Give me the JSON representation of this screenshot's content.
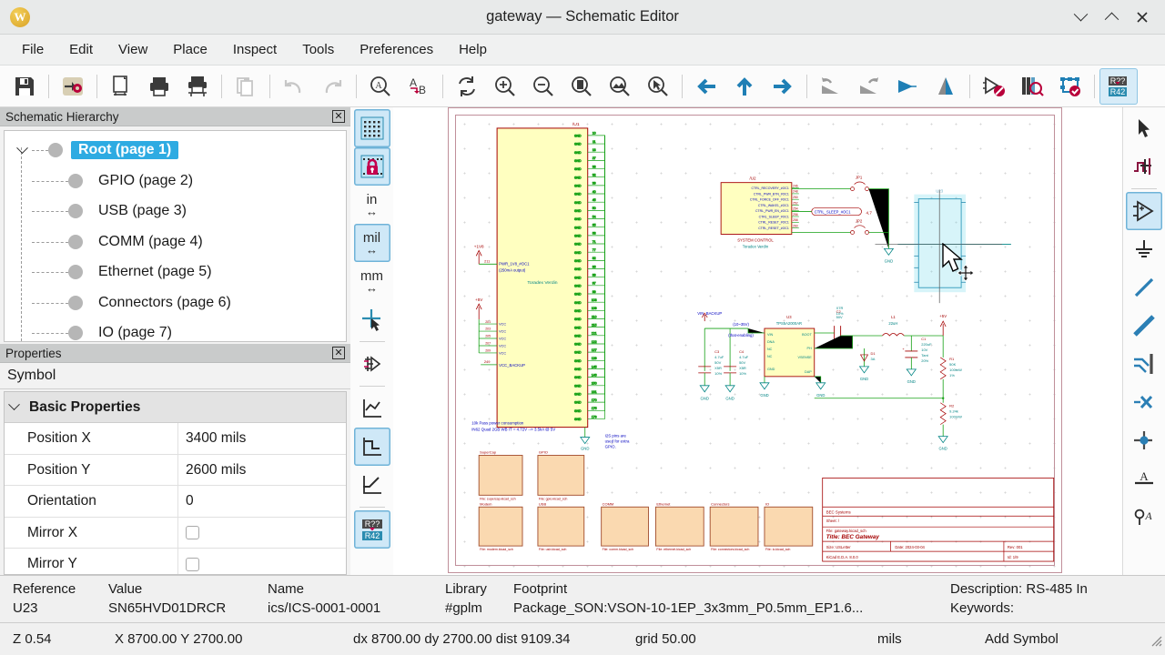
{
  "window": {
    "title": "gateway — Schematic Editor",
    "logo_letter": "W",
    "controls": {
      "minimize": "minimize-icon",
      "maximize": "maximize-icon",
      "close": "×"
    }
  },
  "menubar": {
    "items": [
      "File",
      "Edit",
      "View",
      "Place",
      "Inspect",
      "Tools",
      "Preferences",
      "Help"
    ]
  },
  "toolbar": {
    "items": [
      {
        "name": "save-icon",
        "label": "Save"
      },
      {
        "sep": true
      },
      {
        "name": "open-project-settings-icon",
        "label": "Schematic Setup"
      },
      {
        "sep": true
      },
      {
        "name": "page-settings-icon",
        "label": "Page Settings"
      },
      {
        "name": "print-icon",
        "label": "Print"
      },
      {
        "name": "plot-icon",
        "label": "Plot"
      },
      {
        "sep": true
      },
      {
        "name": "paste-icon",
        "label": "Paste"
      },
      {
        "sep": true
      },
      {
        "name": "undo-icon",
        "label": "Undo"
      },
      {
        "name": "redo-icon",
        "label": "Redo"
      },
      {
        "sep": true
      },
      {
        "name": "find-icon",
        "label": "Find"
      },
      {
        "name": "find-replace-icon",
        "label": "Find and Replace"
      },
      {
        "sep": true
      },
      {
        "name": "refresh-icon",
        "label": "Refresh"
      },
      {
        "name": "zoom-in-icon",
        "label": "Zoom In"
      },
      {
        "name": "zoom-out-icon",
        "label": "Zoom Out"
      },
      {
        "name": "zoom-fit-page-icon",
        "label": "Zoom to Fit Page"
      },
      {
        "name": "zoom-fit-objects-icon",
        "label": "Zoom to Objects"
      },
      {
        "name": "zoom-selection-icon",
        "label": "Zoom to Selection"
      },
      {
        "sep": true
      },
      {
        "name": "leave-sheet-icon",
        "label": "Leave Sheet"
      },
      {
        "name": "up-sheet-icon",
        "label": "Navigate Up"
      },
      {
        "name": "enter-sheet-icon",
        "label": "Enter Sheet"
      },
      {
        "sep": true
      },
      {
        "name": "rotate-ccw-icon",
        "label": "Rotate Counterclockwise"
      },
      {
        "name": "rotate-cw-icon",
        "label": "Rotate Clockwise"
      },
      {
        "name": "mirror-horizontal-icon",
        "label": "Mirror Horizontally"
      },
      {
        "name": "mirror-vertical-icon",
        "label": "Mirror Vertically"
      },
      {
        "sep": true
      },
      {
        "name": "erc-icon",
        "label": "Electrical Rules Checker"
      },
      {
        "name": "symbol-library-browser-icon",
        "label": "Symbol Library Browser"
      },
      {
        "name": "assign-footprints-icon",
        "label": "Assign Footprints"
      },
      {
        "sep": true
      },
      {
        "name": "annotate-icon",
        "label": "Annotate",
        "active": true
      }
    ]
  },
  "hierarchy": {
    "title": "Schematic Hierarchy",
    "close": "✖",
    "items": [
      {
        "label": "Root (page 1)",
        "selected": true
      },
      {
        "label": "GPIO (page 2)",
        "selected": false
      },
      {
        "label": "USB (page 3)",
        "selected": false
      },
      {
        "label": "COMM (page 4)",
        "selected": false
      },
      {
        "label": "Ethernet (page 5)",
        "selected": false
      },
      {
        "label": "Connectors (page 6)",
        "selected": false
      },
      {
        "label": "IO (page 7)",
        "selected": false
      }
    ]
  },
  "properties": {
    "title": "Properties",
    "close": "✖",
    "subtitle": "Symbol",
    "group_label": "Basic Properties",
    "rows": [
      {
        "key": "Position X",
        "value": "3400 mils",
        "type": "text"
      },
      {
        "key": "Position Y",
        "value": "2600 mils",
        "type": "text"
      },
      {
        "key": "Orientation",
        "value": "0",
        "type": "text"
      },
      {
        "key": "Mirror X",
        "value": "",
        "type": "checkbox"
      },
      {
        "key": "Mirror Y",
        "value": "",
        "type": "checkbox"
      }
    ]
  },
  "left_vtoolbar": {
    "items": [
      {
        "name": "grid-visibility-icon",
        "label": "Show Grid",
        "active": true
      },
      {
        "name": "grid-lock-icon",
        "label": "Lock Grid",
        "active": true
      },
      {
        "name": "unit-inches-icon",
        "label": "in",
        "active": false
      },
      {
        "name": "unit-mils-icon",
        "label": "mil",
        "active": true
      },
      {
        "name": "unit-millimeters-icon",
        "label": "mm",
        "active": false
      },
      {
        "name": "full-crosshair-icon",
        "label": "Full Window Crosshair",
        "active": false
      },
      {
        "name": "hidden-pins-icon",
        "label": "Show Hidden Pins",
        "active": false
      },
      {
        "name": "line-mode-free-icon",
        "label": "Free Angle Lines",
        "active": false
      },
      {
        "name": "line-mode-90-icon",
        "label": "90 Degree Lines",
        "active": true
      },
      {
        "name": "line-mode-45-icon",
        "label": "45 Degree Lines",
        "active": false
      },
      {
        "name": "annotate-toggle-icon",
        "label": "Annotation Display",
        "active": true
      }
    ]
  },
  "right_vtoolbar": {
    "items": [
      {
        "name": "select-arrow-icon",
        "label": "Selection Tool",
        "active": false
      },
      {
        "name": "highlight-net-icon",
        "label": "Highlight Net",
        "active": false
      },
      {
        "name": "add-symbol-icon",
        "label": "Add Symbol",
        "active": true
      },
      {
        "name": "add-power-icon",
        "label": "Add Power Symbol",
        "active": false
      },
      {
        "name": "draw-wire-icon",
        "label": "Draw Wire",
        "active": false
      },
      {
        "name": "draw-bus-icon",
        "label": "Draw Bus",
        "active": false
      },
      {
        "name": "bus-entry-icon",
        "label": "Add Bus Entry",
        "active": false
      },
      {
        "name": "no-connect-icon",
        "label": "Add No Connect Flag",
        "active": false
      },
      {
        "name": "junction-icon",
        "label": "Add Junction",
        "active": false
      },
      {
        "name": "net-label-icon",
        "label": "Add Net Label",
        "active": false
      },
      {
        "name": "hierarchical-label-icon",
        "label": "Add Hierarchical Label",
        "active": false
      }
    ]
  },
  "info_panel": {
    "columns": [
      {
        "header": "Reference",
        "value": "U23"
      },
      {
        "header": "Value",
        "value": "SN65HVD01DRCR"
      },
      {
        "header": "Name",
        "value": "ics/ICS-0001-0001"
      },
      {
        "header": "Library",
        "value": "#gplm"
      },
      {
        "header": "Footprint",
        "value": "Package_SON:VSON-10-1EP_3x3mm_P0.5mm_EP1.6..."
      },
      {
        "header": "Description: RS-485 In",
        "value": "Keywords:"
      }
    ]
  },
  "statusbar": {
    "zoom": "Z 0.54",
    "coords": "X 8700.00  Y 2700.00",
    "delta": "dx 8700.00  dy 2700.00  dist 9109.34",
    "grid": "grid 50.00",
    "units": "mils",
    "tool": "Add Symbol"
  },
  "schematic": {
    "main_symbol": {
      "ref": "/U1",
      "caption": "Toradex Verdin",
      "power_labels": [
        "+1V8",
        "+5V"
      ],
      "net_pwr": "PWR_1V8_#OC1",
      "net_pwr_note": "(250mA output)",
      "vcc_pins": [
        "201",
        "203",
        "205",
        "207",
        "209"
      ],
      "vcc_label": "VCC",
      "vcc_backup": "VCC_BACKUP",
      "gnd_label": "GND",
      "gnd_pins": [
        "10",
        "11",
        "18",
        "27",
        "38",
        "32",
        "39",
        "40",
        "45",
        "50",
        "54",
        "65",
        "68",
        "71",
        "77",
        "82",
        "86",
        "89",
        "97",
        "99",
        "103",
        "109",
        "110",
        "115",
        "121",
        "122",
        "127",
        "129",
        "145",
        "146",
        "150",
        "161",
        "170",
        "175",
        "179"
      ],
      "note1": "10k Pass power consumption",
      "note2": "IN62 Quad 2GB WB IT = 4.72V --> 3.5kA @ 5V",
      "note3": "I2S pins are used for extra GPIO."
    },
    "system_control": {
      "ref": "/U2",
      "caption_top": "SYSTEM CONTROL",
      "caption_bottom": "Toradex Verdin",
      "signals": [
        "CTRL_RECOVERY_#OC1",
        "CTRL_PWR_BTN_#OC1",
        "CTRL_FORCE_OFF_#OC1",
        "CTRL_WAKE1_#OC1",
        "CTRL_PWR_EN_#OC1",
        "CTRL_SLEEP_#OC1",
        "CTRL_RESET_#OC1",
        "CTRL_RESET_#OC1"
      ],
      "pins": [
        "246",
        "248",
        "250",
        "252",
        "254",
        "256",
        "258",
        "260"
      ],
      "jumpers": [
        "JP1",
        "JP2"
      ],
      "net_label": "CTRL_SLEEP_#OC1",
      "net_value": "4,7",
      "gnd": "GND"
    },
    "power_supply": {
      "vin_label": "VIN_BACKUP",
      "range": "(10~35V)",
      "note": "(that-enabling)",
      "regulator_ref": "U3",
      "regulator_value": "TPS5A2000AR",
      "regulator_pins_left": [
        "VIN",
        "DNA",
        "NC",
        "NC",
        "GND"
      ],
      "regulator_pins_right": [
        "BOOT",
        "PH",
        "VSENSE",
        "DAP"
      ],
      "caps": [
        {
          "ref": "C3",
          "value": "4.7uF",
          "v": "50V",
          "dielectric": "X5R",
          "tol": "10%"
        },
        {
          "ref": "C4",
          "value": "4.7uF",
          "v": "50V",
          "dielectric": "X5R",
          "tol": "10%"
        },
        {
          "ref": "C2",
          "value": "50V",
          "dielectric": "X7R",
          "tol": "10%"
        },
        {
          "ref": "C1",
          "value": "220uF",
          "v": "10V",
          "dielectric": "Tant",
          "tol": "20%"
        }
      ],
      "inductor": {
        "ref": "L1",
        "value": "22uH"
      },
      "diode": {
        "ref": "D1",
        "value": "3A"
      },
      "resistors": [
        {
          "ref": "R1",
          "value": "50K",
          "power": "100mW",
          "tol": "1%"
        },
        {
          "ref": "R2",
          "value": "9.24k",
          "power": "100mW"
        }
      ],
      "rail": "+5V",
      "gnd": "GND"
    },
    "sheets": [
      {
        "name": "SuperCap",
        "file": "File: supercap.kicad_sch"
      },
      {
        "name": "GPIO",
        "file": "File: gpio.kicad_sch"
      },
      {
        "name": "Modem",
        "file": "File: modem.kicad_sch"
      },
      {
        "name": "USB",
        "file": "File: usb.kicad_sch"
      },
      {
        "name": "COMM",
        "file": "File: comm.kicad_sch"
      },
      {
        "name": "Ethernet",
        "file": "File: ethernet.kicad_sch"
      },
      {
        "name": "Connectors",
        "file": "File: connectors.kicad_sch"
      },
      {
        "name": "IO",
        "file": "File: io.kicad_sch"
      }
    ],
    "title_block": {
      "company": "BEC Systems",
      "sheet": "Sheet: /",
      "file": "File: gateway.kicad_sch",
      "title": "Title: BEC Gateway",
      "size": "Size: USLetter",
      "date": "Date: 2024-03-04",
      "rev": "Rev: 001",
      "kicad": "KiCad E.D.A. 8.0.0",
      "id": "Id: 1/9"
    },
    "placing_symbol": {
      "ref": "U23",
      "highlight_color": "#6fd6e8"
    }
  },
  "colors": {
    "accent": "#2eabe2",
    "sheet_border": "#c08f9a",
    "component_body": "#ffffc0",
    "sheet_body": "#fad9b0",
    "wire": "#008484",
    "net_green": "#14a014",
    "label_red": "#a40000",
    "note_blue": "#0000c0"
  }
}
